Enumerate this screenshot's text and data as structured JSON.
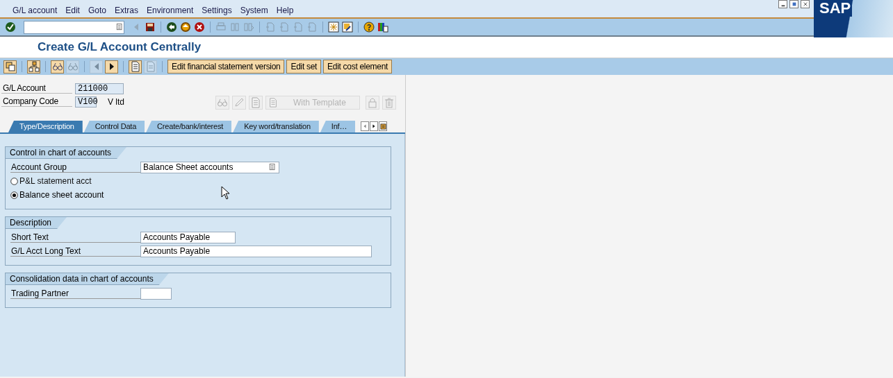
{
  "menu": [
    {
      "label": "G/L account"
    },
    {
      "label": "Edit"
    },
    {
      "label": "Goto"
    },
    {
      "label": "Extras"
    },
    {
      "label": "Environment"
    },
    {
      "label": "Settings"
    },
    {
      "label": "System"
    },
    {
      "label": "Help"
    }
  ],
  "logo": "SAP",
  "system_toolbar": [
    {
      "kind": "enter",
      "disabled": false
    },
    {
      "kind": "command-field"
    },
    {
      "kind": "collapse",
      "disabled": true
    },
    {
      "kind": "save",
      "disabled": false
    },
    {
      "kind": "sep"
    },
    {
      "kind": "back",
      "disabled": false
    },
    {
      "kind": "exit",
      "disabled": false
    },
    {
      "kind": "cancel",
      "disabled": false
    },
    {
      "kind": "sep"
    },
    {
      "kind": "print",
      "disabled": true
    },
    {
      "kind": "find",
      "disabled": true
    },
    {
      "kind": "find-next",
      "disabled": true
    },
    {
      "kind": "sep"
    },
    {
      "kind": "page",
      "disabled": true
    },
    {
      "kind": "page",
      "disabled": true
    },
    {
      "kind": "page",
      "disabled": true
    },
    {
      "kind": "page",
      "disabled": true
    },
    {
      "kind": "sep"
    },
    {
      "kind": "session",
      "disabled": false
    },
    {
      "kind": "shortcut",
      "disabled": false
    },
    {
      "kind": "sep"
    },
    {
      "kind": "help",
      "disabled": false
    },
    {
      "kind": "layout",
      "disabled": false
    }
  ],
  "title": "Create G/L Account Centrally",
  "app_toolbar": [
    {
      "kind": "switch",
      "disabled": false
    },
    {
      "kind": "sep"
    },
    {
      "kind": "hierarchy",
      "disabled": false
    },
    {
      "kind": "sep"
    },
    {
      "kind": "glasses",
      "disabled": false
    },
    {
      "kind": "glasses",
      "disabled": true
    },
    {
      "kind": "sep"
    },
    {
      "kind": "prev",
      "disabled": true
    },
    {
      "kind": "next",
      "disabled": false
    },
    {
      "kind": "sep"
    },
    {
      "kind": "doc",
      "disabled": false
    },
    {
      "kind": "note",
      "disabled": true
    },
    {
      "kind": "sep"
    }
  ],
  "app_buttons": [
    {
      "label": "Edit financial statement version"
    },
    {
      "label": "Edit set"
    },
    {
      "label": "Edit cost element"
    }
  ],
  "header_fields": [
    {
      "label": "G/L Account",
      "value": "211000"
    },
    {
      "label": "Company Code",
      "value": "V100",
      "description": "V ltd"
    }
  ],
  "object_actions": [
    {
      "kind": "glasses",
      "disabled": true
    },
    {
      "kind": "pencil",
      "disabled": true
    },
    {
      "kind": "doc",
      "disabled": true
    },
    {
      "kind": "text",
      "label": "With Template",
      "disabled": true
    },
    {
      "kind": "lock",
      "disabled": true
    },
    {
      "kind": "trash",
      "disabled": true
    }
  ],
  "tabs": [
    {
      "label": "Type/Description",
      "selected": true
    },
    {
      "label": "Control Data",
      "selected": false
    },
    {
      "label": "Create/bank/interest",
      "selected": false
    },
    {
      "label": "Key word/translation",
      "selected": false
    },
    {
      "label": "Inf…",
      "selected": false
    }
  ],
  "groups": [
    {
      "title": "Control in chart of accounts",
      "rows": [
        {
          "kind": "dropdown",
          "label": "Account Group",
          "value": "Balance Sheet accounts"
        },
        {
          "kind": "radio",
          "label": "P&L statement acct",
          "selected": false
        },
        {
          "kind": "radio",
          "label": "Balance sheet account",
          "selected": true
        }
      ]
    },
    {
      "title": "Description",
      "rows": [
        {
          "kind": "text",
          "label": "Short Text",
          "value": "Accounts Payable"
        },
        {
          "kind": "text",
          "label": "G/L Acct Long Text",
          "value": "Accounts Payable"
        }
      ]
    },
    {
      "title": "Consolidation data in chart of accounts",
      "rows": [
        {
          "kind": "text",
          "label": "Trading Partner"
        }
      ]
    }
  ]
}
